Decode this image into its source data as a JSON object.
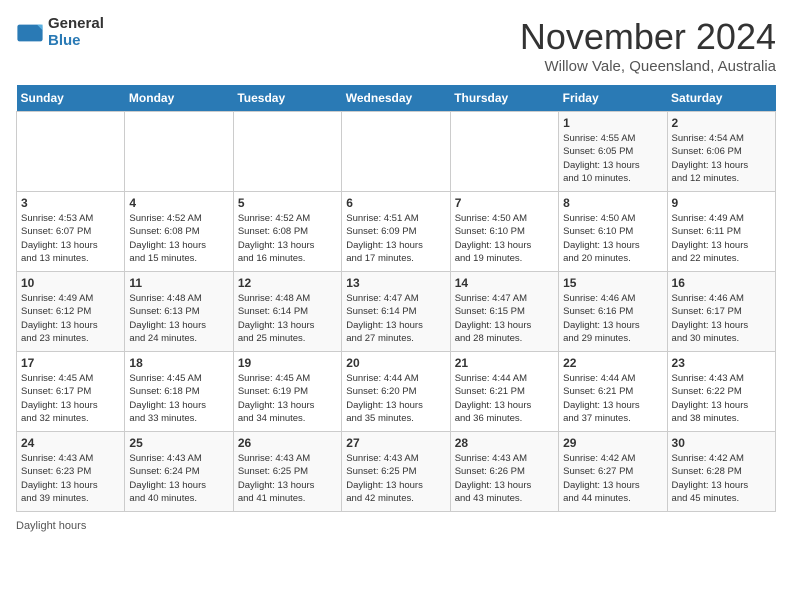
{
  "header": {
    "logo_general": "General",
    "logo_blue": "Blue",
    "title": "November 2024",
    "location": "Willow Vale, Queensland, Australia"
  },
  "weekdays": [
    "Sunday",
    "Monday",
    "Tuesday",
    "Wednesday",
    "Thursday",
    "Friday",
    "Saturday"
  ],
  "weeks": [
    [
      {
        "day": "",
        "info": ""
      },
      {
        "day": "",
        "info": ""
      },
      {
        "day": "",
        "info": ""
      },
      {
        "day": "",
        "info": ""
      },
      {
        "day": "",
        "info": ""
      },
      {
        "day": "1",
        "info": "Sunrise: 4:55 AM\nSunset: 6:05 PM\nDaylight: 13 hours\nand 10 minutes."
      },
      {
        "day": "2",
        "info": "Sunrise: 4:54 AM\nSunset: 6:06 PM\nDaylight: 13 hours\nand 12 minutes."
      }
    ],
    [
      {
        "day": "3",
        "info": "Sunrise: 4:53 AM\nSunset: 6:07 PM\nDaylight: 13 hours\nand 13 minutes."
      },
      {
        "day": "4",
        "info": "Sunrise: 4:52 AM\nSunset: 6:08 PM\nDaylight: 13 hours\nand 15 minutes."
      },
      {
        "day": "5",
        "info": "Sunrise: 4:52 AM\nSunset: 6:08 PM\nDaylight: 13 hours\nand 16 minutes."
      },
      {
        "day": "6",
        "info": "Sunrise: 4:51 AM\nSunset: 6:09 PM\nDaylight: 13 hours\nand 17 minutes."
      },
      {
        "day": "7",
        "info": "Sunrise: 4:50 AM\nSunset: 6:10 PM\nDaylight: 13 hours\nand 19 minutes."
      },
      {
        "day": "8",
        "info": "Sunrise: 4:50 AM\nSunset: 6:10 PM\nDaylight: 13 hours\nand 20 minutes."
      },
      {
        "day": "9",
        "info": "Sunrise: 4:49 AM\nSunset: 6:11 PM\nDaylight: 13 hours\nand 22 minutes."
      }
    ],
    [
      {
        "day": "10",
        "info": "Sunrise: 4:49 AM\nSunset: 6:12 PM\nDaylight: 13 hours\nand 23 minutes."
      },
      {
        "day": "11",
        "info": "Sunrise: 4:48 AM\nSunset: 6:13 PM\nDaylight: 13 hours\nand 24 minutes."
      },
      {
        "day": "12",
        "info": "Sunrise: 4:48 AM\nSunset: 6:14 PM\nDaylight: 13 hours\nand 25 minutes."
      },
      {
        "day": "13",
        "info": "Sunrise: 4:47 AM\nSunset: 6:14 PM\nDaylight: 13 hours\nand 27 minutes."
      },
      {
        "day": "14",
        "info": "Sunrise: 4:47 AM\nSunset: 6:15 PM\nDaylight: 13 hours\nand 28 minutes."
      },
      {
        "day": "15",
        "info": "Sunrise: 4:46 AM\nSunset: 6:16 PM\nDaylight: 13 hours\nand 29 minutes."
      },
      {
        "day": "16",
        "info": "Sunrise: 4:46 AM\nSunset: 6:17 PM\nDaylight: 13 hours\nand 30 minutes."
      }
    ],
    [
      {
        "day": "17",
        "info": "Sunrise: 4:45 AM\nSunset: 6:17 PM\nDaylight: 13 hours\nand 32 minutes."
      },
      {
        "day": "18",
        "info": "Sunrise: 4:45 AM\nSunset: 6:18 PM\nDaylight: 13 hours\nand 33 minutes."
      },
      {
        "day": "19",
        "info": "Sunrise: 4:45 AM\nSunset: 6:19 PM\nDaylight: 13 hours\nand 34 minutes."
      },
      {
        "day": "20",
        "info": "Sunrise: 4:44 AM\nSunset: 6:20 PM\nDaylight: 13 hours\nand 35 minutes."
      },
      {
        "day": "21",
        "info": "Sunrise: 4:44 AM\nSunset: 6:21 PM\nDaylight: 13 hours\nand 36 minutes."
      },
      {
        "day": "22",
        "info": "Sunrise: 4:44 AM\nSunset: 6:21 PM\nDaylight: 13 hours\nand 37 minutes."
      },
      {
        "day": "23",
        "info": "Sunrise: 4:43 AM\nSunset: 6:22 PM\nDaylight: 13 hours\nand 38 minutes."
      }
    ],
    [
      {
        "day": "24",
        "info": "Sunrise: 4:43 AM\nSunset: 6:23 PM\nDaylight: 13 hours\nand 39 minutes."
      },
      {
        "day": "25",
        "info": "Sunrise: 4:43 AM\nSunset: 6:24 PM\nDaylight: 13 hours\nand 40 minutes."
      },
      {
        "day": "26",
        "info": "Sunrise: 4:43 AM\nSunset: 6:25 PM\nDaylight: 13 hours\nand 41 minutes."
      },
      {
        "day": "27",
        "info": "Sunrise: 4:43 AM\nSunset: 6:25 PM\nDaylight: 13 hours\nand 42 minutes."
      },
      {
        "day": "28",
        "info": "Sunrise: 4:43 AM\nSunset: 6:26 PM\nDaylight: 13 hours\nand 43 minutes."
      },
      {
        "day": "29",
        "info": "Sunrise: 4:42 AM\nSunset: 6:27 PM\nDaylight: 13 hours\nand 44 minutes."
      },
      {
        "day": "30",
        "info": "Sunrise: 4:42 AM\nSunset: 6:28 PM\nDaylight: 13 hours\nand 45 minutes."
      }
    ]
  ],
  "legend": {
    "daylight_hours": "Daylight hours"
  }
}
